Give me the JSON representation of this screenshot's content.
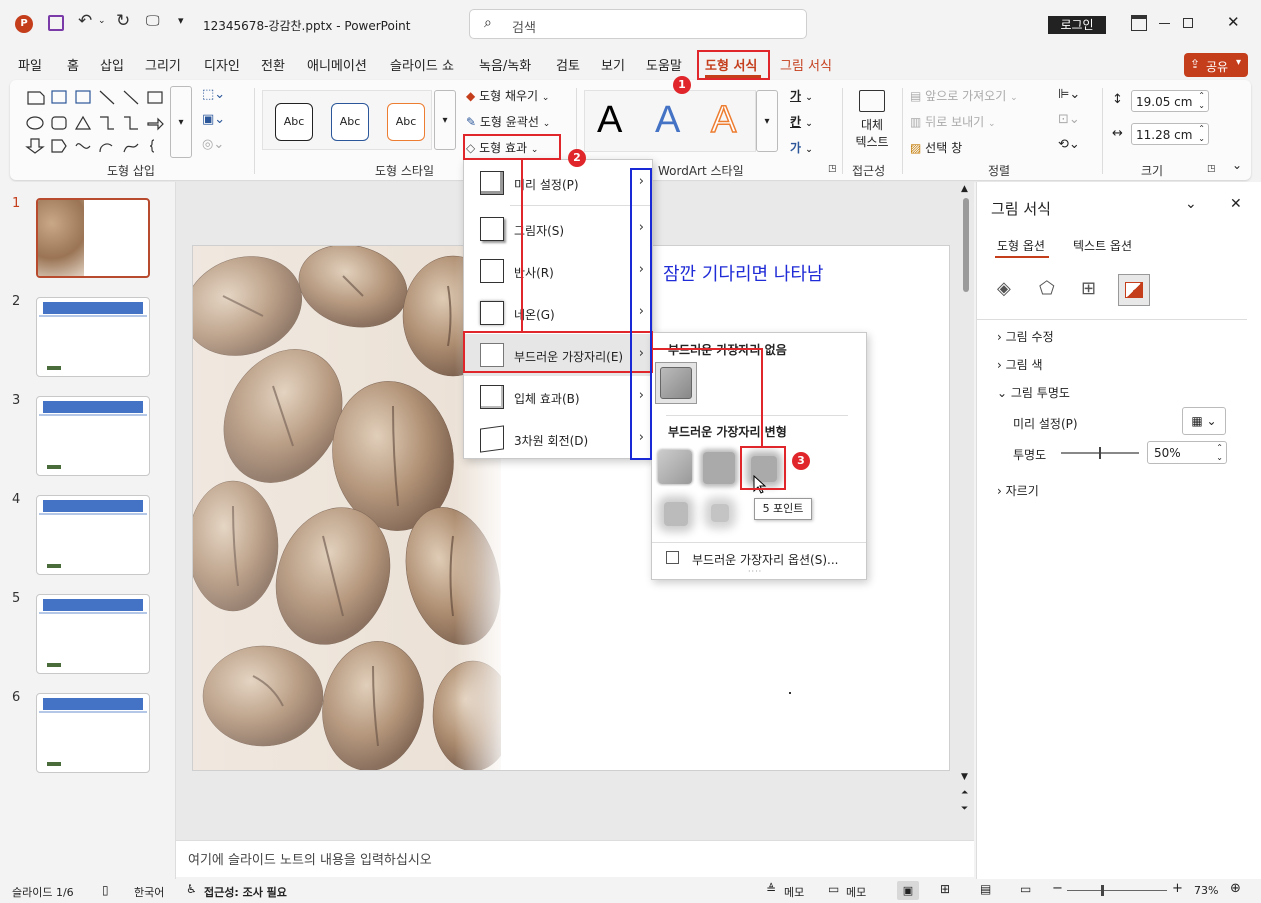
{
  "title_bar": {
    "file_name": "12345678-강감찬.pptx",
    "separator": "-",
    "app_name": "PowerPoint",
    "search_placeholder": "검색",
    "login": "로그인"
  },
  "menu_tabs": [
    "파일",
    "홈",
    "삽입",
    "그리기",
    "디자인",
    "전환",
    "애니메이션",
    "슬라이드 쇼",
    "녹음/녹화",
    "검토",
    "보기",
    "도움말",
    "도형 서식",
    "그림 서식"
  ],
  "share_label": "공유",
  "ribbon": {
    "shape_insert_label": "도형 삽입",
    "style_sample": "Abc",
    "shape_fill": "도형 채우기",
    "shape_outline": "도형 윤곽선",
    "shape_effects": "도형 효과",
    "shape_style_label": "도형 스타일",
    "wordart_letter": "A",
    "wordart_label": "WordArt 스타일",
    "text_fill_glyph": "가",
    "text_outline_glyph": "칸",
    "text_effect_glyph": "가",
    "alt_text_l1": "대체",
    "alt_text_l2": "텍스트",
    "accessibility_label": "접근성",
    "bring_forward": "앞으로 가져오기",
    "send_backward": "뒤로 보내기",
    "selection_pane": "선택 창",
    "arrange_label": "정렬",
    "height": "19.05 cm",
    "width": "11.28 cm",
    "size_label": "크기"
  },
  "badges": [
    "1",
    "2",
    "3"
  ],
  "effects_menu": [
    "미리 설정(P)",
    "그림자(S)",
    "반사(R)",
    "네온(G)",
    "부드러운 가장자리(E)",
    "입체 효과(B)",
    "3차원 회전(D)"
  ],
  "soft_edge_submenu": {
    "none_header": "부드러운 가장자리 없음",
    "variations_header": "부드러운 가장자리 변형",
    "tooltip": "5 포인트",
    "options": "부드러운 가장자리 옵션(S)..."
  },
  "slide_numbers": [
    "1",
    "2",
    "3",
    "4",
    "5",
    "6"
  ],
  "slide_title": "잠깐 기다리면 나타남",
  "notes_placeholder": "여기에 슬라이드 노트의 내용을 입력하십시오",
  "pane": {
    "title": "그림 서식",
    "tab_shape": "도형 옵션",
    "tab_text": "텍스트 옵션",
    "sections": [
      "그림 수정",
      "그림 색",
      "그림 투명도",
      "자르기"
    ],
    "preset_label": "미리 설정(P)",
    "transparency_label": "투명도",
    "transparency_value": "50%"
  },
  "status": {
    "slide_info": "슬라이드 1/6",
    "language": "한국어",
    "accessibility": "접근성: 조사 필요",
    "notes_btn": "메모",
    "comments_btn": "메모",
    "zoom": "73%"
  },
  "colors": {
    "accent": "#c43e1c",
    "marker_red": "#e0262a",
    "marker_blue": "#1a29d6",
    "title_blue": "#1f2bd6",
    "thumb_bar": "#4472c4"
  }
}
